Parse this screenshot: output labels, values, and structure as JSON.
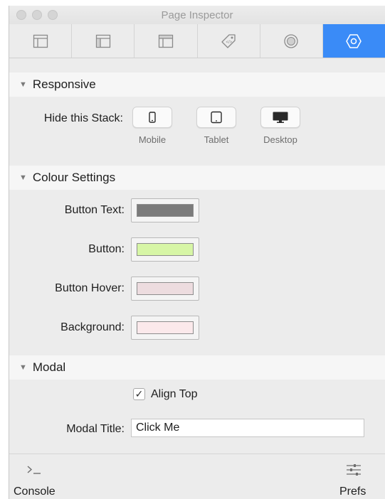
{
  "window": {
    "title": "Page Inspector"
  },
  "tabs": [
    {
      "icon": "page-layout-icon",
      "active": false
    },
    {
      "icon": "sidebar-layout-icon",
      "active": false
    },
    {
      "icon": "header-layout-icon",
      "active": false
    },
    {
      "icon": "tag-icon",
      "active": false
    },
    {
      "icon": "circle-target-icon",
      "active": false
    },
    {
      "icon": "hexagon-settings-icon",
      "active": true
    }
  ],
  "responsive": {
    "header": "Responsive",
    "hide_label": "Hide this Stack:",
    "devices": [
      {
        "name": "Mobile",
        "icon": "mobile-icon"
      },
      {
        "name": "Tablet",
        "icon": "tablet-icon"
      },
      {
        "name": "Desktop",
        "icon": "desktop-icon"
      }
    ]
  },
  "colour": {
    "header": "Colour Settings",
    "items": [
      {
        "label": "Button Text:",
        "color": "#7b7b7b"
      },
      {
        "label": "Button:",
        "color": "#d7f6a6"
      },
      {
        "label": "Button Hover:",
        "color": "#eddcdf"
      },
      {
        "label": "Background:",
        "color": "#fbe9eb"
      }
    ]
  },
  "modal": {
    "header": "Modal",
    "align_top_label": "Align Top",
    "align_top_checked": true,
    "title_label": "Modal Title:",
    "title_value": "Click Me"
  },
  "bottom": {
    "console_label": "Console",
    "console_icon": "terminal-icon",
    "prefs_label": "Prefs",
    "prefs_icon": "sliders-icon"
  },
  "accent_color": "#3a8bf7"
}
